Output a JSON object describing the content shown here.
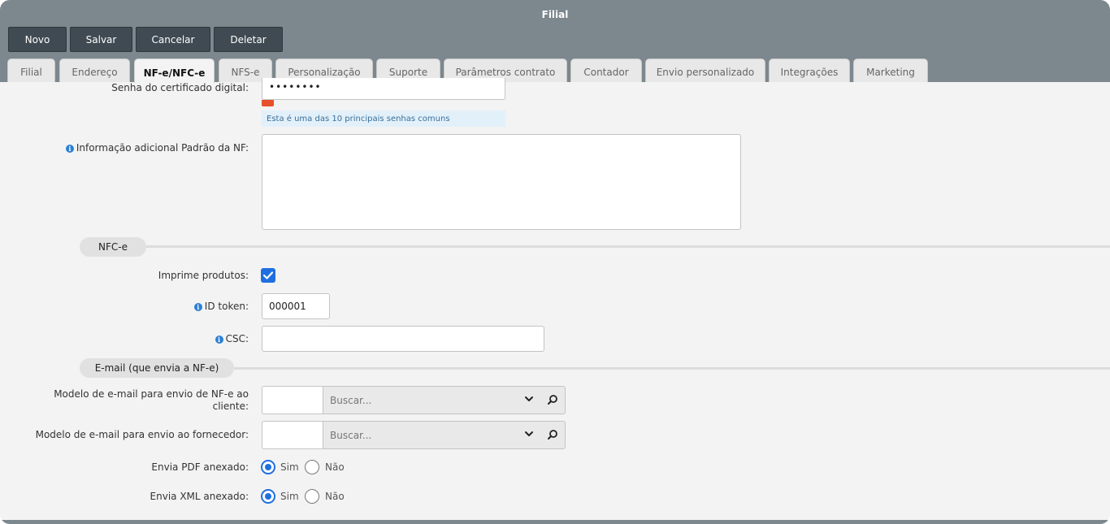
{
  "window": {
    "title": "Filial"
  },
  "toolbar": {
    "novo": "Novo",
    "salvar": "Salvar",
    "cancelar": "Cancelar",
    "deletar": "Deletar"
  },
  "tabs": [
    {
      "label": "Filial"
    },
    {
      "label": "Endereço"
    },
    {
      "label": "NF-e/NFC-e",
      "active": true
    },
    {
      "label": "NFS-e"
    },
    {
      "label": "Personalização"
    },
    {
      "label": "Suporte"
    },
    {
      "label": "Parâmetros contrato"
    },
    {
      "label": "Contador"
    },
    {
      "label": "Envio personalizado"
    },
    {
      "label": "Integrações"
    },
    {
      "label": "Marketing"
    }
  ],
  "form": {
    "senha_label": "Senha do certificado digital:",
    "senha_value": "••••••••",
    "senha_hint": "Esta é uma das 10 principais senhas comuns",
    "info_label": "Informação adicional Padrão da NF:",
    "info_value": ""
  },
  "nfce": {
    "section_title": "NFC-e",
    "imprime_label": "Imprime produtos:",
    "imprime_checked": true,
    "id_token_label": "ID token:",
    "id_token_value": "000001",
    "csc_label": "CSC:",
    "csc_value": ""
  },
  "email": {
    "section_title": "E-mail (que envia a NF-e)",
    "modelo_cliente_label_1": "Modelo de e-mail para envio de NF-e ao",
    "modelo_cliente_label_2": "cliente:",
    "modelo_fornecedor_label": "Modelo de e-mail para envio ao fornecedor:",
    "search_placeholder": "Buscar...",
    "pdf_label": "Envia PDF anexado:",
    "xml_label": "Envia XML anexado:",
    "sim": "Sim",
    "nao": "Não",
    "pdf_selected": "Sim",
    "xml_selected": "Sim"
  },
  "colors": {
    "header": "#7c878e",
    "button": "#3f4a52",
    "accent": "#1f6fe0",
    "weak_password": "#e4512b"
  }
}
